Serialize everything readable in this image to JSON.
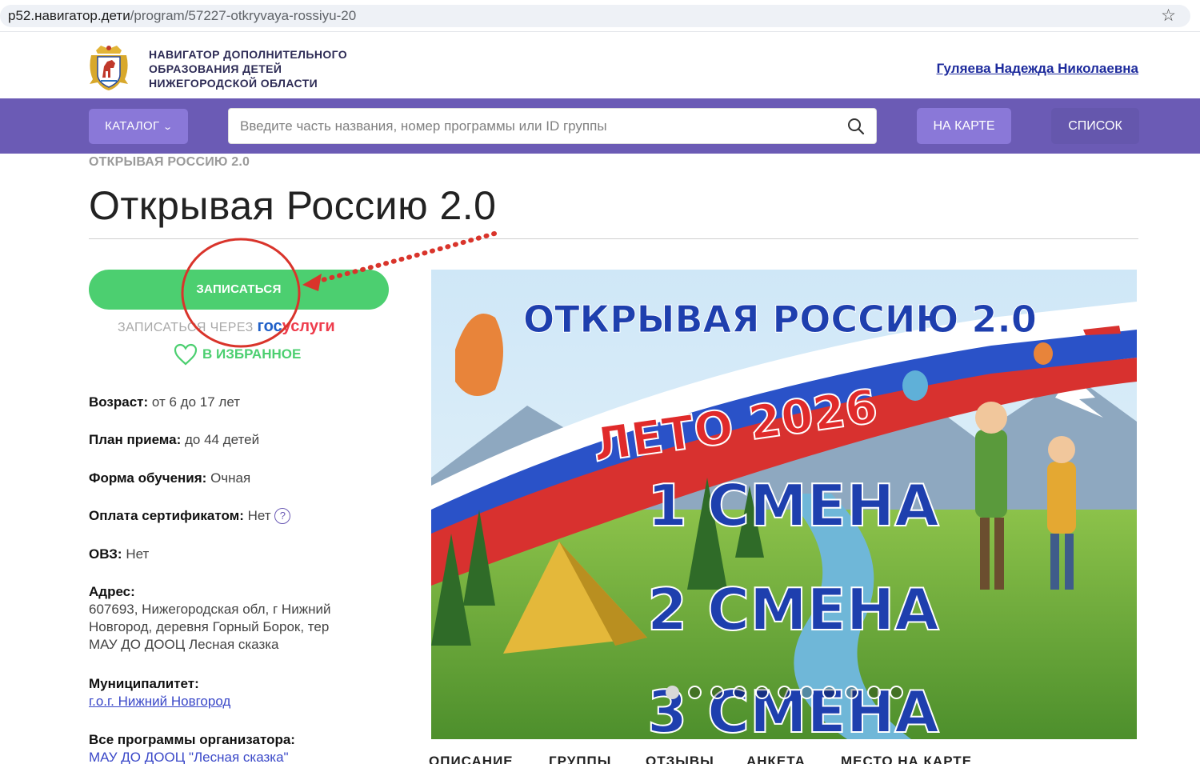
{
  "browser": {
    "url_host": "p52.навигатор.дети",
    "url_path": "/program/57227-otkryvaya-rossiyu-20"
  },
  "header": {
    "site_name_line1": "НАВИГАТОР ДОПОЛНИТЕЛЬНОГО",
    "site_name_line2": "ОБРАЗОВАНИЯ ДЕТЕЙ",
    "site_name_line3": "НИЖЕГОРОДСКОЙ ОБЛАСТИ",
    "user_name": "Гуляева Надежда Николаевна"
  },
  "nav": {
    "catalog_label": "КАТАЛОГ",
    "search_placeholder": "Введите часть названия, номер программы или ID группы",
    "map_label": "НА КАРТЕ",
    "list_label": "СПИСОК"
  },
  "program": {
    "breadcrumb": "ОТКРЫВАЯ РОССИЮ 2.0",
    "title": "Открывая Россию 2.0",
    "enroll_label": "ЗАПИСАТЬСЯ",
    "gos_prefix": "ЗАПИСАТЬСЯ ЧЕРЕЗ",
    "gos_brand_1": "гос",
    "gos_brand_2": "услуги",
    "favorite_label": "В ИЗБРАННОЕ",
    "age_label": "Возраст:",
    "age_value": "от 6 до 17 лет",
    "plan_label": "План приема:",
    "plan_value": "до 44 детей",
    "form_label": "Форма обучения:",
    "form_value": "Очная",
    "cert_label": "Оплата сертификатом:",
    "cert_value": "Нет",
    "cert_help": "?",
    "ovz_label": "ОВЗ:",
    "ovz_value": "Нет",
    "address_label": "Адрес:",
    "address_line1": "607693, Нижегородская обл, г Нижний",
    "address_line2": "Новгород, деревня Горный Борок, тер",
    "address_line3": "МАУ ДО ДООЦ Лесная сказка",
    "municipality_label": "Муниципалитет:",
    "municipality_value": "г.о.г. Нижний Новгород",
    "organizer_label": "Все программы организатора:",
    "organizer_value": "МАУ ДО ДООЦ \"Лесная сказка\""
  },
  "banner": {
    "title": "ОТКРЫВАЯ РОССИЮ 2.0",
    "season": "ЛЕТО 2026",
    "shift1": "1 СМЕНА",
    "shift2": "2 СМЕНА",
    "shift3": "3 СМЕНА",
    "slide_count": 11,
    "active_slide": 1
  },
  "tabs": [
    "ОПИСАНИЕ",
    "ГРУППЫ",
    "ОТЗЫВЫ",
    "АНКЕТА",
    "МЕСТО НА КАРТЕ"
  ],
  "colors": {
    "nav_purple": "#6b5bb5",
    "button_purple": "#8a78d8",
    "enroll_green": "#4ccf70",
    "annotation_red": "#d9342b"
  }
}
